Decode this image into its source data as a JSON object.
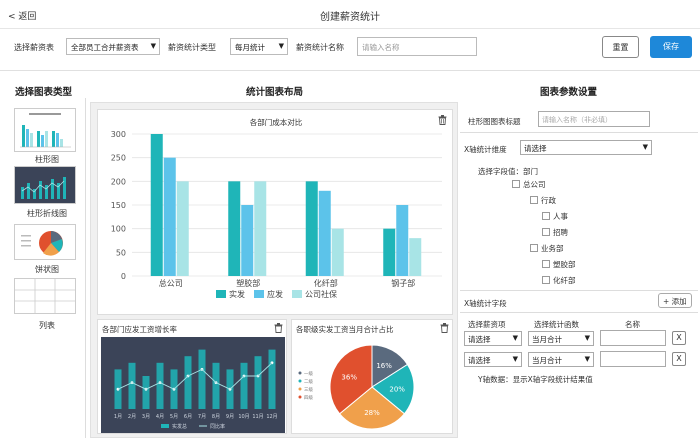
{
  "header": {
    "back_label": "< 返回",
    "title": "创建薪资统计"
  },
  "filter": {
    "select_salary_label": "选择薪资表",
    "select_salary_value": "全部员工合并薪资表",
    "stat_type_label": "薪资统计类型",
    "stat_type_value": "每月统计",
    "stat_name_label": "薪资统计名称",
    "stat_name_placeholder": "请输入名称",
    "reset_label": "重置",
    "save_label": "保存"
  },
  "sections": {
    "chart_types": "选择图表类型",
    "layout": "统计图表布局",
    "params": "图表参数设置"
  },
  "chart_types": [
    {
      "label": "柱形图"
    },
    {
      "label": "柱形折线图"
    },
    {
      "label": "饼状图"
    },
    {
      "label": "列表"
    }
  ],
  "main_chart": {
    "title": "各部门成本对比",
    "chart_data": {
      "type": "bar",
      "categories": [
        "总公司",
        "塑胶部",
        "化纤部",
        "钢子部"
      ],
      "series": [
        {
          "name": "实发",
          "values": [
            300,
            200,
            200,
            100
          ],
          "color": "#1fb5b8"
        },
        {
          "name": "应发",
          "values": [
            250,
            150,
            180,
            150
          ],
          "color": "#5cc3ea"
        },
        {
          "name": "公司社保",
          "values": [
            200,
            200,
            100,
            80
          ],
          "color": "#a8e4e6"
        }
      ],
      "ylim": [
        0,
        300
      ],
      "yticks": [
        "300",
        "250",
        "200",
        "150",
        "100",
        "50",
        "0"
      ],
      "grid": true,
      "legend": "bottom"
    }
  },
  "small_chart_1": {
    "title": "各部门应发工资增长率",
    "chart_data": {
      "type": "bar",
      "categories": [
        "1月",
        "2月",
        "3月",
        "4月",
        "5月",
        "6月",
        "7月",
        "8月",
        "9月",
        "10月",
        "11月",
        "12月"
      ],
      "series": [
        {
          "name": "应发",
          "values": [
            6,
            7,
            5,
            7,
            6,
            8,
            9,
            7,
            6,
            7,
            8,
            9
          ]
        },
        {
          "name": "同比",
          "values": [
            3,
            4,
            3,
            4,
            3,
            5,
            6,
            4,
            3,
            5,
            5,
            7
          ]
        }
      ],
      "legend": "bottom"
    },
    "legend_labels": [
      "实发总",
      "同比率"
    ]
  },
  "small_chart_2": {
    "title": "各职级实发工资当月合计占比",
    "chart_data": {
      "type": "pie",
      "slices": [
        {
          "label": "16%",
          "value": 16,
          "color": "#5a6a7e"
        },
        {
          "label": "20%",
          "value": 20,
          "color": "#1fb5b8"
        },
        {
          "label": "28%",
          "value": 28,
          "color": "#f0a04b"
        },
        {
          "label": "36%",
          "value": 36,
          "color": "#e0502e"
        }
      ]
    },
    "legend_items": [
      "一级",
      "二级",
      "三级",
      "四级"
    ]
  },
  "params": {
    "bar_title_label": "柱形图图表标题",
    "bar_title_placeholder": "请输入名称（非必填）",
    "x_dim_label": "X轴统计维度",
    "x_dim_value": "请选择",
    "field_label": "选择字段值：部门",
    "tree": [
      {
        "label": "总公司",
        "level": 0
      },
      {
        "label": "行政",
        "level": 1
      },
      {
        "label": "人事",
        "level": 2
      },
      {
        "label": "招聘",
        "level": 2
      },
      {
        "label": "业务部",
        "level": 1
      },
      {
        "label": "塑胶部",
        "level": 2
      },
      {
        "label": "化纤部",
        "level": 2
      }
    ],
    "x_field_label": "X轴统计字段",
    "add_label": "+ 添加",
    "table_headers": [
      "选择薪资项",
      "选择统计函数",
      "名称"
    ],
    "rows": [
      {
        "item": "请选择",
        "func": "当月合计",
        "delete": "X"
      },
      {
        "item": "请选择",
        "func": "当月合计",
        "delete": "X"
      }
    ],
    "y_data_label": "Y轴数据：显示X轴字段统计结果值"
  }
}
